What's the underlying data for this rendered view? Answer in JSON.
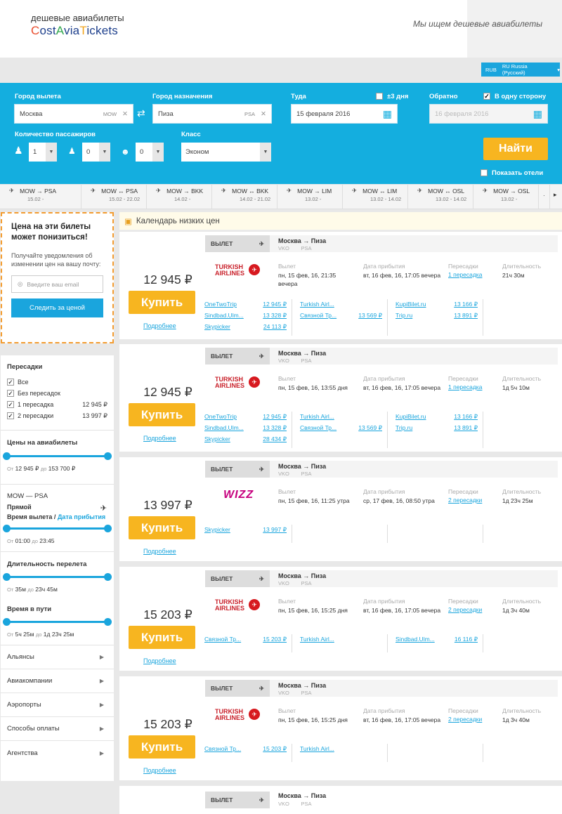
{
  "header": {
    "logo_top": "дешевые авиабилеты",
    "logo_main": [
      "C",
      "ost",
      "A",
      "via",
      "T",
      "ickets"
    ],
    "tagline": "Мы ищем дешевые авиабилеты"
  },
  "locale": {
    "currency": "RUB",
    "language": "RU Russia (Русский)"
  },
  "search": {
    "from_label": "Город вылета",
    "from_value": "Москва",
    "from_code": "MOW",
    "to_label": "Город назначения",
    "to_value": "Пиза",
    "to_code": "PSA",
    "depart_label": "Туда",
    "flex_label": "±3 дня",
    "depart_value": "15 февраля 2016",
    "return_label": "Обратно",
    "oneway_label": "В одну сторону",
    "return_placeholder": "16 февраля 2016",
    "pax_label": "Количество пассажиров",
    "adults": "1",
    "children": "0",
    "infants": "0",
    "class_label": "Класс",
    "class_value": "Эконом",
    "find_label": "Найти",
    "hotels_label": "Показать отели"
  },
  "routes": [
    {
      "title": "MOW → PSA",
      "dates": "15.02 -"
    },
    {
      "title": "MOW ↔ PSA",
      "dates": "15.02 - 22.02"
    },
    {
      "title": "MOW → BKK",
      "dates": "14.02 -"
    },
    {
      "title": "MOW ↔ BKK",
      "dates": "14.02 - 21.02"
    },
    {
      "title": "MOW → LIM",
      "dates": "13.02 -"
    },
    {
      "title": "MOW ↔ LIM",
      "dates": "13.02 - 14.02"
    },
    {
      "title": "MOW ↔ OSL",
      "dates": "13.02 - 14.02"
    },
    {
      "title": "MOW → OSL",
      "dates": "13.02 -"
    }
  ],
  "promo": {
    "title": "Цена на эти билеты может понизиться!",
    "text": "Получайте уведомления об изменении цен на вашу почту:",
    "email_placeholder": "Введите ваш email",
    "button": "Следить за ценой"
  },
  "filters": {
    "stops_title": "Пересадки",
    "stops": [
      {
        "label": "Все",
        "price": ""
      },
      {
        "label": "Без пересадок",
        "price": ""
      },
      {
        "label": "1 пересадка",
        "price": "12 945 ₽"
      },
      {
        "label": "2 пересадки",
        "price": "13 997 ₽"
      }
    ],
    "price_title": "Цены на авиабилеты",
    "price_from": "12 945 ₽",
    "price_to": "153 700 ₽",
    "route_title": "MOW — PSA",
    "direct_label": "Прямой",
    "time_label_a": "Время вылета",
    "time_label_b": "Дата прибытия",
    "time_from": "01:00",
    "time_to": "23:45",
    "duration_title": "Длительность перелета",
    "duration_from": "35м",
    "duration_to": "23ч 45м",
    "travel_title": "Время в пути",
    "travel_from": "5ч 25м",
    "travel_to": "1д 23ч 25м",
    "word_from": "От",
    "word_to": "до",
    "sections": [
      "Альянсы",
      "Авиакомпании",
      "Аэропорты",
      "Способы оплаты",
      "Агентства"
    ]
  },
  "calendar_label": "Календарь низких цен",
  "labels": {
    "buy": "Купить",
    "more": "Подробнее",
    "depart": "ВЫЛЕТ",
    "route": "Москва → Пиза",
    "codes": "VKO        PSA",
    "k_dep": "Вылет",
    "k_arr": "Дата прибытия",
    "k_stops": "Пересадки",
    "k_dur": "Длительность"
  },
  "results": [
    {
      "price": "12 945 ₽",
      "airline": "TURKISH AIRLINES",
      "dep": "пн, 15 фев, 16, 21:35 вечера",
      "arr": "вт, 16 фев, 16, 17:05 вечера",
      "stops": "1 пересадка",
      "duration": "21ч 30м",
      "agents": [
        [
          {
            "n": "OneTwoTrip",
            "p": "12 945 ₽"
          },
          {
            "n": "Sindbad.Ulm...",
            "p": "13 328 ₽"
          },
          {
            "n": "Skypicker",
            "p": "24 113 ₽"
          }
        ],
        [
          {
            "n": "Turkish Airl...",
            "p": ""
          },
          {
            "n": "Связной Тр...",
            "p": "13 569 ₽"
          }
        ],
        [
          {
            "n": "KupiBilet.ru",
            "p": "13 166 ₽"
          },
          {
            "n": "Trip.ru",
            "p": "13 891 ₽"
          }
        ]
      ]
    },
    {
      "price": "12 945 ₽",
      "airline": "TURKISH AIRLINES",
      "dep": "пн, 15 фев, 16, 13:55 дня",
      "arr": "вт, 16 фев, 16, 17:05 вечера",
      "stops": "1 пересадка",
      "duration": "1д 5ч 10м",
      "agents": [
        [
          {
            "n": "OneTwoTrip",
            "p": "12 945 ₽"
          },
          {
            "n": "Sindbad.Ulm...",
            "p": "13 328 ₽"
          },
          {
            "n": "Skypicker",
            "p": "28 434 ₽"
          }
        ],
        [
          {
            "n": "Turkish Airl...",
            "p": ""
          },
          {
            "n": "Связной Тр...",
            "p": "13 569 ₽"
          }
        ],
        [
          {
            "n": "KupiBilet.ru",
            "p": "13 166 ₽"
          },
          {
            "n": "Trip.ru",
            "p": "13 891 ₽"
          }
        ]
      ]
    },
    {
      "price": "13 997 ₽",
      "airline": "WIZZ",
      "dep": "пн, 15 фев, 16, 11:25 утра",
      "arr": "ср, 17 фев, 16, 08:50 утра",
      "stops": "2 пересадки",
      "duration": "1д 23ч 25м",
      "agents": [
        [
          {
            "n": "Skypicker",
            "p": "13 997 ₽"
          }
        ]
      ]
    },
    {
      "price": "15 203 ₽",
      "airline": "TURKISH AIRLINES",
      "dep": "пн, 15 фев, 16, 15:25 дня",
      "arr": "вт, 16 фев, 16, 17:05 вечера",
      "stops": "2 пересадки",
      "duration": "1д 3ч 40м",
      "agents": [
        [
          {
            "n": "Связной Тр...",
            "p": "15 203 ₽"
          }
        ],
        [
          {
            "n": "Turkish Airl...",
            "p": ""
          }
        ],
        [
          {
            "n": "Sindbad.Ulm...",
            "p": "16 116 ₽"
          }
        ]
      ]
    },
    {
      "price": "15 203 ₽",
      "airline": "TURKISH AIRLINES",
      "dep": "пн, 15 фев, 16, 15:25 дня",
      "arr": "вт, 16 фев, 16, 17:05 вечера",
      "stops": "2 пересадки",
      "duration": "1д 3ч 40м",
      "agents": [
        [
          {
            "n": "Связной Тр...",
            "p": "15 203 ₽"
          }
        ],
        [
          {
            "n": "Turkish Airl...",
            "p": ""
          }
        ]
      ]
    }
  ],
  "colors": {
    "accent": "#14aedf",
    "buy": "#f7b520",
    "promo_border": "#f39c30"
  }
}
